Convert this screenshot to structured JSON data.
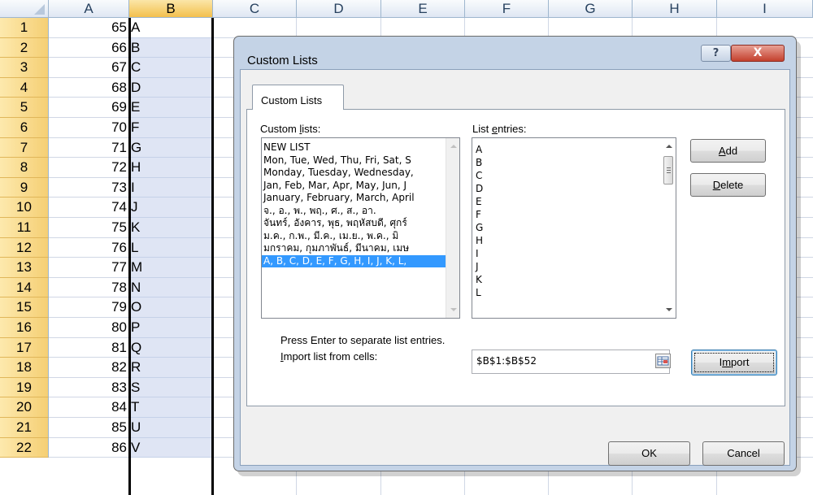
{
  "sheet": {
    "columns": [
      "A",
      "B",
      "C",
      "D",
      "E",
      "F",
      "G",
      "H",
      "I"
    ],
    "rows": [
      {
        "n": "1",
        "a": "65",
        "b": "A"
      },
      {
        "n": "2",
        "a": "66",
        "b": "B"
      },
      {
        "n": "3",
        "a": "67",
        "b": "C"
      },
      {
        "n": "4",
        "a": "68",
        "b": "D"
      },
      {
        "n": "5",
        "a": "69",
        "b": "E"
      },
      {
        "n": "6",
        "a": "70",
        "b": "F"
      },
      {
        "n": "7",
        "a": "71",
        "b": "G"
      },
      {
        "n": "8",
        "a": "72",
        "b": "H"
      },
      {
        "n": "9",
        "a": "73",
        "b": "I"
      },
      {
        "n": "10",
        "a": "74",
        "b": "J"
      },
      {
        "n": "11",
        "a": "75",
        "b": "K"
      },
      {
        "n": "12",
        "a": "76",
        "b": "L"
      },
      {
        "n": "13",
        "a": "77",
        "b": "M"
      },
      {
        "n": "14",
        "a": "78",
        "b": "N"
      },
      {
        "n": "15",
        "a": "79",
        "b": "O"
      },
      {
        "n": "16",
        "a": "80",
        "b": "P"
      },
      {
        "n": "17",
        "a": "81",
        "b": "Q"
      },
      {
        "n": "18",
        "a": "82",
        "b": "R"
      },
      {
        "n": "19",
        "a": "83",
        "b": "S"
      },
      {
        "n": "20",
        "a": "84",
        "b": "T"
      },
      {
        "n": "21",
        "a": "85",
        "b": "U"
      },
      {
        "n": "22",
        "a": "86",
        "b": "V"
      }
    ],
    "selected_column": "B"
  },
  "dialog": {
    "title": "Custom Lists",
    "help_glyph": "?",
    "close_glyph": "X",
    "tab_label": "Custom Lists",
    "custom_lists_label_pre": "Custom ",
    "custom_lists_label_ul": "l",
    "custom_lists_label_post": "ists:",
    "list_entries_label_pre": "List ",
    "list_entries_label_ul": "e",
    "list_entries_label_post": "ntries:",
    "custom_lists": [
      "NEW LIST",
      "Mon, Tue, Wed, Thu, Fri, Sat, S",
      "Monday, Tuesday, Wednesday,",
      "Jan, Feb, Mar, Apr, May, Jun, J",
      "January, February, March, April",
      "จ., อ., พ., พฤ., ศ., ส., อา.",
      "จันทร์, อังคาร, พุธ, พฤหัสบดี, ศุกร์",
      "ม.ค., ก.พ., มี.ค., เม.ย., พ.ค., มิ",
      "มกราคม, กุมภาพันธ์, มีนาคม, เมษ",
      "A, B, C, D, E, F, G, H, I, J, K, L,"
    ],
    "selected_list_index": 9,
    "list_entries": [
      "A",
      "B",
      "C",
      "D",
      "E",
      "F",
      "G",
      "H",
      "I",
      "J",
      "K",
      "L"
    ],
    "add_pre": "",
    "add_ul": "A",
    "add_post": "dd",
    "delete_pre": "",
    "delete_ul": "D",
    "delete_post": "elete",
    "hint": "Press Enter to separate list entries.",
    "import_label_pre": "",
    "import_label_ul": "I",
    "import_label_post": "mport list from cells:",
    "import_range": "$B$1:$B$52",
    "import_btn_pre": "I",
    "import_btn_ul": "m",
    "import_btn_post": "port",
    "ok": "OK",
    "cancel": "Cancel"
  },
  "colors": {
    "selection_blue": "#3399ff",
    "column_b_fill": "#dfe5f4",
    "row_header_fill": "#f5cf74"
  }
}
